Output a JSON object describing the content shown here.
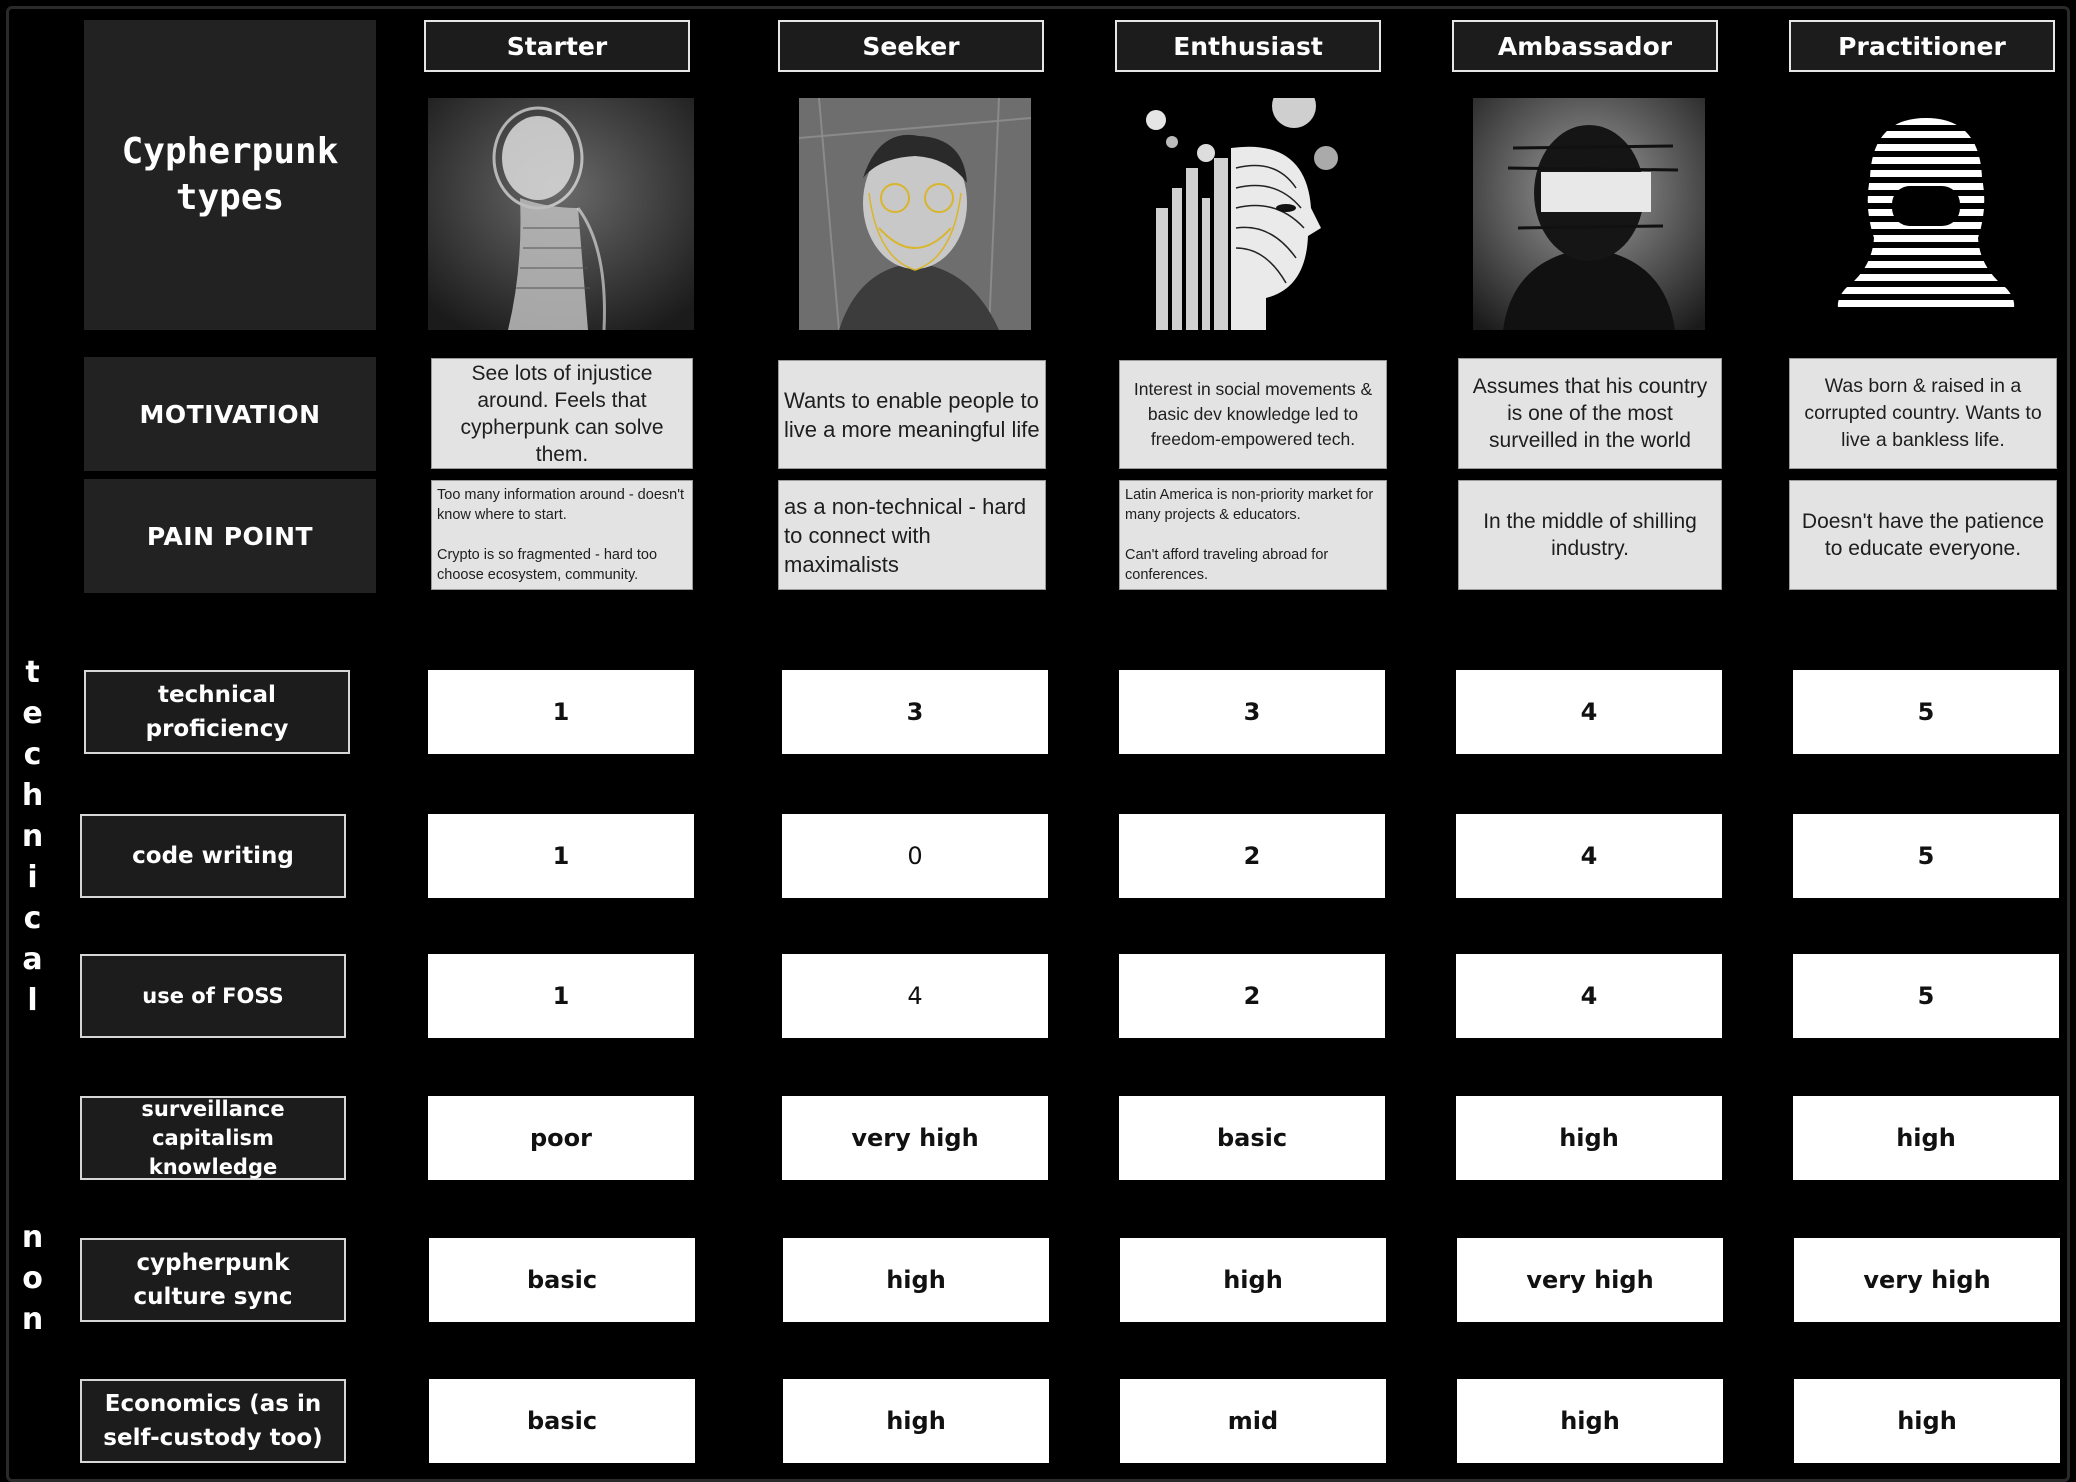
{
  "title": "Cypherpunk\ntypes",
  "columns": [
    {
      "key": "starter",
      "name": "Starter",
      "icon": "ghost-figure-portrait"
    },
    {
      "key": "seeker",
      "name": "Seeker",
      "icon": "face-mesh-portrait"
    },
    {
      "key": "enthusiast",
      "name": "Enthusiast",
      "icon": "abstract-head-collage"
    },
    {
      "key": "ambassador",
      "name": "Ambassador",
      "icon": "censored-face-portrait"
    },
    {
      "key": "practitioner",
      "name": "Practitioner",
      "icon": "striped-balaclava-portrait"
    }
  ],
  "labels": {
    "motivation": "MOTIVATION",
    "pain_point": "PAIN POINT"
  },
  "motivation": [
    "See lots of injustice around. Feels that cypherpunk can solve them.",
    "Wants to enable people to live a more meaningful life",
    "Interest in social movements & basic dev knowledge led to freedom-empowered tech.",
    "Assumes that his country is one of the most surveilled in the world",
    "Was born & raised in a corrupted country. Wants to live a bankless life."
  ],
  "pain_point": [
    "Too many information around - doesn't know where to start.\n\nCrypto is so fragmented - hard too choose ecosystem, community.",
    "as a non-technical - hard to connect with maximalists",
    "Latin America is non-priority market for many projects & educators.\n\nCan't afford traveling abroad for conferences.",
    "In the middle of shilling industry.",
    "Doesn't have the patience to educate everyone."
  ],
  "group_labels": {
    "technical": "technical",
    "non": "non"
  },
  "rows": [
    {
      "label": "technical proficiency",
      "values": [
        "1",
        "3",
        "3",
        "4",
        "5"
      ]
    },
    {
      "label": "code writing",
      "values": [
        "1",
        "0",
        "2",
        "4",
        "5"
      ]
    },
    {
      "label": "use of FOSS",
      "values": [
        "1",
        "4",
        "2",
        "4",
        "5"
      ]
    },
    {
      "label": "surveillance capitalism knowledge",
      "values": [
        "poor",
        "very high",
        "basic",
        "high",
        "high"
      ]
    },
    {
      "label": "cypherpunk culture sync",
      "values": [
        "basic",
        "high",
        "high",
        "very high",
        "very high"
      ]
    },
    {
      "label": "Economics (as in self-custody too)",
      "values": [
        "basic",
        "high",
        "mid",
        "high",
        "high"
      ]
    }
  ]
}
